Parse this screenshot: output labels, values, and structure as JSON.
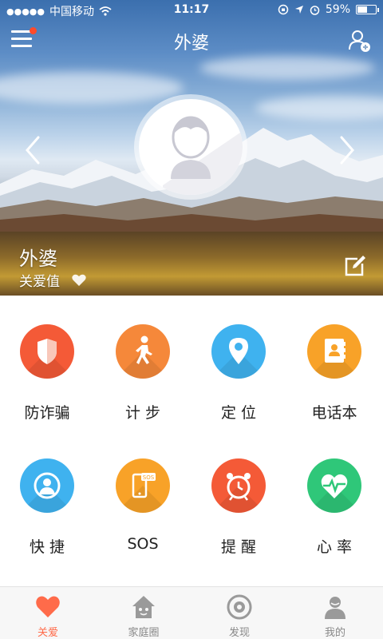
{
  "status_bar": {
    "signal_dots": "●●●●●",
    "carrier": "中国移动",
    "time": "11:17",
    "battery_text": "59%",
    "battery_level": 0.59
  },
  "nav": {
    "title": "外婆",
    "menu_icon": "hamburger-menu-icon",
    "menu_badge_color": "#ff4a2a",
    "add_user_icon": "add-user-icon"
  },
  "profile": {
    "name": "外婆",
    "care_label": "关爱值",
    "prev_icon": "chevron-left-icon",
    "next_icon": "chevron-right-icon",
    "edit_icon": "edit-icon"
  },
  "features": [
    {
      "label": "防诈骗",
      "icon": "shield-icon",
      "color": "#f45a37"
    },
    {
      "label": "计 步",
      "icon": "walking-icon",
      "color": "#f5883a"
    },
    {
      "label": "定 位",
      "icon": "location-pin-icon",
      "color": "#3fb2ef"
    },
    {
      "label": "电话本",
      "icon": "phonebook-icon",
      "color": "#f8a228"
    },
    {
      "label": "快 捷",
      "icon": "contact-card-icon",
      "color": "#3fb2ef"
    },
    {
      "label": "SOS",
      "icon": "sos-phone-icon",
      "color": "#f8a228"
    },
    {
      "label": "提 醒",
      "icon": "alarm-clock-icon",
      "color": "#f45a37"
    },
    {
      "label": "心 率",
      "icon": "heart-rate-icon",
      "color": "#2fc779"
    }
  ],
  "tabs": [
    {
      "label": "关爱",
      "icon": "heart-icon",
      "active": true
    },
    {
      "label": "家庭圈",
      "icon": "home-icon",
      "active": false
    },
    {
      "label": "发现",
      "icon": "discover-icon",
      "active": false
    },
    {
      "label": "我的",
      "icon": "user-icon",
      "active": false
    }
  ],
  "colors": {
    "accent": "#ff6b4a",
    "tab_inactive": "#888888"
  }
}
